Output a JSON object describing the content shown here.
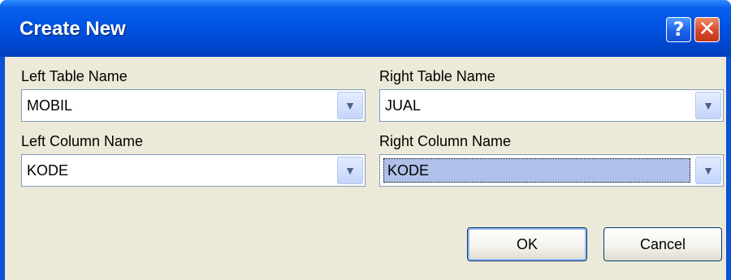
{
  "window": {
    "title": "Create New",
    "help_glyph": "?",
    "close_glyph": "✕"
  },
  "form": {
    "left_table": {
      "label": "Left Table Name",
      "value": "MOBIL"
    },
    "right_table": {
      "label": "Right Table Name",
      "value": "JUAL"
    },
    "left_column": {
      "label": "Left Column Name",
      "value": "KODE"
    },
    "right_column": {
      "label": "Right Column Name",
      "value": "KODE"
    },
    "dropdown_glyph": "▼"
  },
  "buttons": {
    "ok": "OK",
    "cancel": "Cancel"
  },
  "colors": {
    "titlebar": "#0054e3",
    "client_bg": "#ece9d8",
    "selection": "#b0c0e8",
    "close_button": "#d9472a"
  },
  "icons": [
    "help-icon",
    "close-icon",
    "chevron-down-icon"
  ]
}
